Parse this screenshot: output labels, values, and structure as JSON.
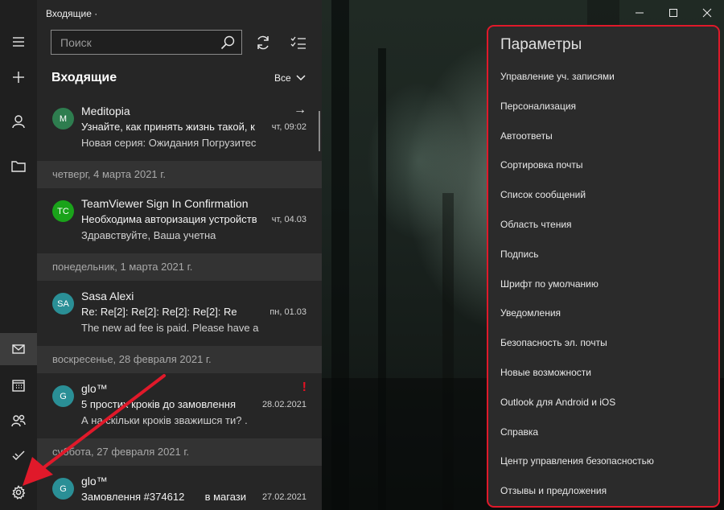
{
  "window": {
    "title": "Входящие ·"
  },
  "nav": {
    "items": [
      {
        "icon": "hamburger-icon"
      },
      {
        "icon": "plus-icon"
      },
      {
        "icon": "account-icon"
      },
      {
        "icon": "folder-icon"
      },
      {
        "icon": "mail-icon"
      },
      {
        "icon": "calendar-icon"
      },
      {
        "icon": "people-icon"
      },
      {
        "icon": "todo-icon"
      },
      {
        "icon": "gear-icon"
      }
    ]
  },
  "list": {
    "search_placeholder": "Поиск",
    "folder": "Входящие",
    "filter": "Все",
    "entries": [
      {
        "kind": "msg",
        "initials": "M",
        "avatar_color": "#2e7d4f",
        "sender": "Meditopia",
        "subject": "Узнайте, как принять жизнь такой, к",
        "preview": "Новая серия: Ожидания Погрузитес",
        "date": "чт, 09:02",
        "icon": "→"
      },
      {
        "kind": "sep",
        "label": "четверг, 4 марта 2021 г."
      },
      {
        "kind": "msg",
        "initials": "TC",
        "avatar_color": "#1aa31a",
        "sender": "TeamViewer Sign In Confirmation",
        "subject": "Необходима авторизация устройств",
        "preview": "Здравствуйте, Ваша учетна",
        "date": "чт, 04.03",
        "icon": ""
      },
      {
        "kind": "sep",
        "label": "понедельник, 1 марта 2021 г."
      },
      {
        "kind": "msg",
        "initials": "SA",
        "avatar_color": "#2a8f96",
        "sender": "Sasa Alexi",
        "subject": "Re: Re[2]: Re[2]: Re[2]: Re[2]: Re",
        "preview": "The new ad fee is paid. Please have a",
        "date": "пн, 01.03",
        "icon": ""
      },
      {
        "kind": "sep",
        "label": "воскресенье, 28 февраля 2021 г."
      },
      {
        "kind": "msg",
        "initials": "G",
        "avatar_color": "#2a8f96",
        "sender": "glo™",
        "subject": "5 простих кроків до замовлення",
        "preview": "А на скільки кроків зважишся ти? .",
        "date": "28.02.2021",
        "icon": "!"
      },
      {
        "kind": "sep",
        "label": "суббота, 27 февраля 2021 г."
      },
      {
        "kind": "msg",
        "initials": "G",
        "avatar_color": "#2a8f96",
        "sender": "glo™",
        "subject": "Замовлення #374612       в магази",
        "preview": "",
        "date": "27.02.2021",
        "icon": ""
      }
    ]
  },
  "settings": {
    "title": "Параметры",
    "items": [
      "Управление уч. записями",
      "Персонализация",
      "Автоответы",
      "Сортировка почты",
      "Список сообщений",
      "Область чтения",
      "Подпись",
      "Шрифт по умолчанию",
      "Уведомления",
      "Безопасность эл. почты",
      "Новые возможности",
      "Outlook для Android и iOS",
      "Справка",
      "Центр управления безопасностью",
      "Отзывы и предложения"
    ]
  },
  "colors": {
    "accent_red": "#e0192a",
    "flag_red": "#e81123"
  }
}
